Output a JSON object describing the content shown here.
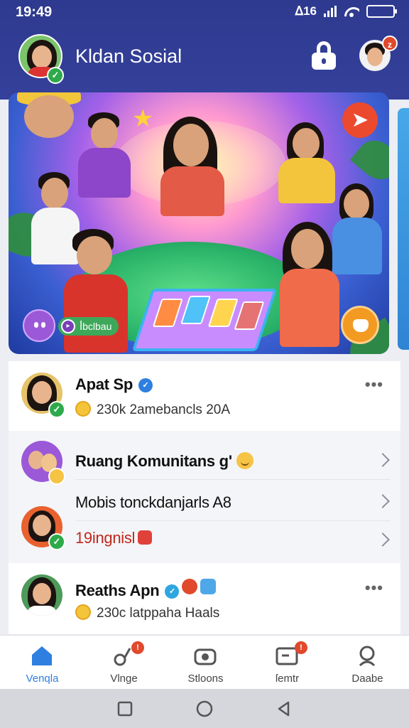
{
  "status_bar": {
    "time": "19:49",
    "signal_label": "ᐃ16"
  },
  "header": {
    "title": "Kldan Sosial",
    "profile_badge": "z",
    "accent_color": "#35409a"
  },
  "hero": {
    "share_icon": "share-icon",
    "chip_label": "ꟾbclbau",
    "sticker_icon": "sticker-icon",
    "emoji_icon": "emoji-icon"
  },
  "feed": {
    "post1": {
      "name": "Apat Sp",
      "sub": "230k 2amebancls 20A"
    },
    "community_label": "Ruang Komunitans g'",
    "item_mobis": "Mobis tonckdanjarls A8",
    "item_ingnisl": "19ingnisl",
    "post2": {
      "name": "Reaths Apn",
      "sub": "230c latppaha Haals"
    }
  },
  "bottom_nav": {
    "items": [
      {
        "label": "Venqla",
        "icon": "home-icon",
        "badge": ""
      },
      {
        "label": "Vlnge",
        "icon": "music-icon",
        "badge": "!"
      },
      {
        "label": "Stloons",
        "icon": "camera-icon",
        "badge": ""
      },
      {
        "label": "ſemtr",
        "icon": "message-icon",
        "badge": "!"
      },
      {
        "label": "Daabe",
        "icon": "search-icon",
        "badge": ""
      }
    ]
  }
}
